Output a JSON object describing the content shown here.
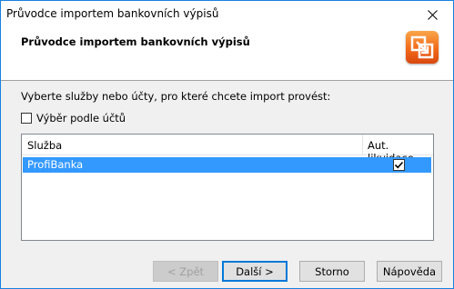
{
  "window": {
    "title": "Průvodce importem bankovních výpisů"
  },
  "header": {
    "title": "Průvodce importem bankovních výpisů"
  },
  "instruction": "Vyberte služby nebo účty, pro které chcete import provést:",
  "account_selection": {
    "label": "Výběr podle účtů",
    "checked": false
  },
  "list": {
    "columns": [
      "Služba",
      "Aut. likvidace"
    ],
    "rows": [
      {
        "service": "ProfiBanka",
        "auto_liquidation": true,
        "selected": true
      }
    ]
  },
  "buttons": {
    "back": "< Zpět",
    "next": "Další >",
    "cancel": "Storno",
    "help": "Nápověda"
  },
  "colors": {
    "selection": "#3399ff",
    "logo": "#f26a1a",
    "accent": "#0078d7"
  }
}
